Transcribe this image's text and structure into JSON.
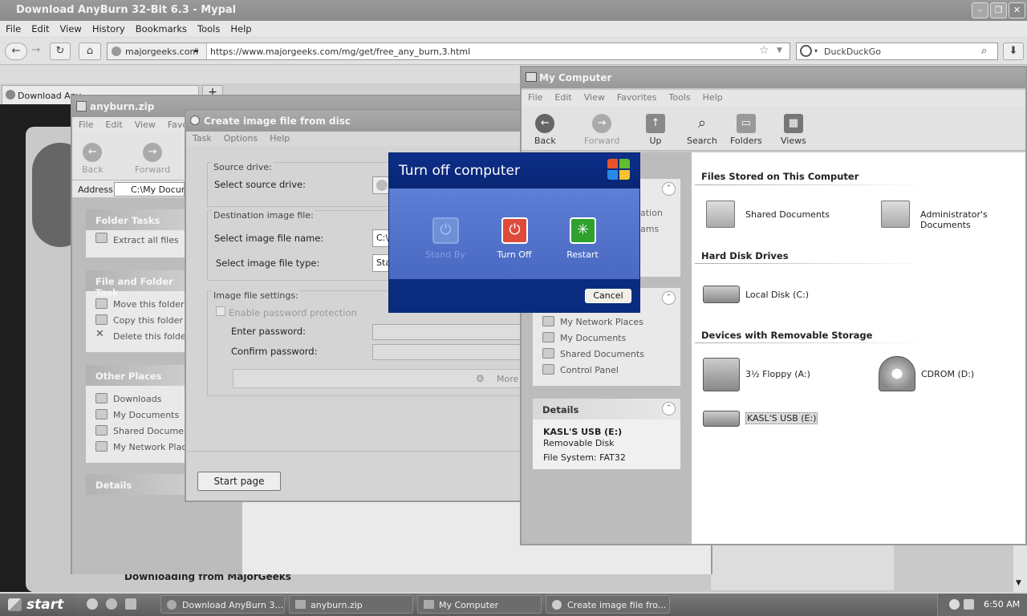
{
  "browser": {
    "title": "Download AnyBurn 32-Bit 6.3 - Mypal",
    "menu": [
      "File",
      "Edit",
      "View",
      "History",
      "Bookmarks",
      "Tools",
      "Help"
    ],
    "site_identity": "majorgeeks.com",
    "url": "https://www.majorgeeks.com/mg/get/free_any_burn,3.html",
    "search_engine": "DuckDuckGo",
    "tab_label": "Download Any",
    "page_heading": "Downloading from MajorGeeks"
  },
  "zip_window": {
    "title": "anyburn.zip",
    "menu": [
      "File",
      "Edit",
      "View",
      "Favo"
    ],
    "back": "Back",
    "forward": "Forward",
    "address_label": "Address",
    "address_value": "C:\\My Docume",
    "folder_tasks": {
      "title": "Folder Tasks",
      "items": [
        "Extract all files"
      ]
    },
    "file_folder_tasks": {
      "title": "File and Folder Task",
      "items": [
        "Move this folder",
        "Copy this folder",
        "Delete this folder"
      ]
    },
    "other_places": {
      "title": "Other Places",
      "items": [
        "Downloads",
        "My Documents",
        "Shared Documents",
        "My Network Places"
      ]
    },
    "details": {
      "title": "Details"
    }
  },
  "anyburn": {
    "title": "Create image file from disc",
    "menu": [
      "Task",
      "Options",
      "Help"
    ],
    "source_group": "Source drive:",
    "select_source": "Select source drive:",
    "dest_group": "Destination image file:",
    "select_name": "Select image file name:",
    "name_value": "C:\\",
    "select_type": "Select image file type:",
    "type_value": "Sta",
    "settings_group": "Image file settings:",
    "enable_password": "Enable password protection",
    "enter_password": "Enter password:",
    "confirm_password": "Confirm password:",
    "more": "More",
    "start_page": "Start page"
  },
  "mycomputer": {
    "title": "My Computer",
    "menu": [
      "File",
      "Edit",
      "View",
      "Favorites",
      "Tools",
      "Help"
    ],
    "toolbar": [
      "Back",
      "Forward",
      "Up",
      "Search",
      "Folders",
      "Views"
    ],
    "system_tasks_partial": [
      "ation",
      "ams"
    ],
    "other_places": [
      "My Network Places",
      "My Documents",
      "Shared Documents",
      "Control Panel"
    ],
    "details": {
      "title": "Details",
      "name": "KASL'S USB (E:)",
      "type": "Removable Disk",
      "fs": "File System: FAT32"
    },
    "sections": {
      "stored": {
        "title": "Files Stored on This Computer",
        "items": [
          "Shared Documents",
          "Administrator's Documents"
        ]
      },
      "hdd": {
        "title": "Hard Disk Drives",
        "items": [
          "Local Disk (C:)"
        ]
      },
      "removable": {
        "title": "Devices with Removable Storage",
        "items": [
          "3½ Floppy (A:)",
          "CDROM (D:)",
          "KASL'S USB (E:)"
        ]
      }
    }
  },
  "dialog": {
    "title": "Turn off computer",
    "standby": "Stand By",
    "turnoff": "Turn Off",
    "restart": "Restart",
    "cancel": "Cancel"
  },
  "taskbar": {
    "start": "start",
    "tasks": [
      "Download AnyBurn 3...",
      "anyburn.zip",
      "My Computer",
      "Create image file fro..."
    ],
    "time": "6:50 AM"
  },
  "colors": {
    "dialog_blue": "#0c2f8a",
    "turnoff_red": "#e04a3a",
    "restart_green": "#2ea12e"
  }
}
